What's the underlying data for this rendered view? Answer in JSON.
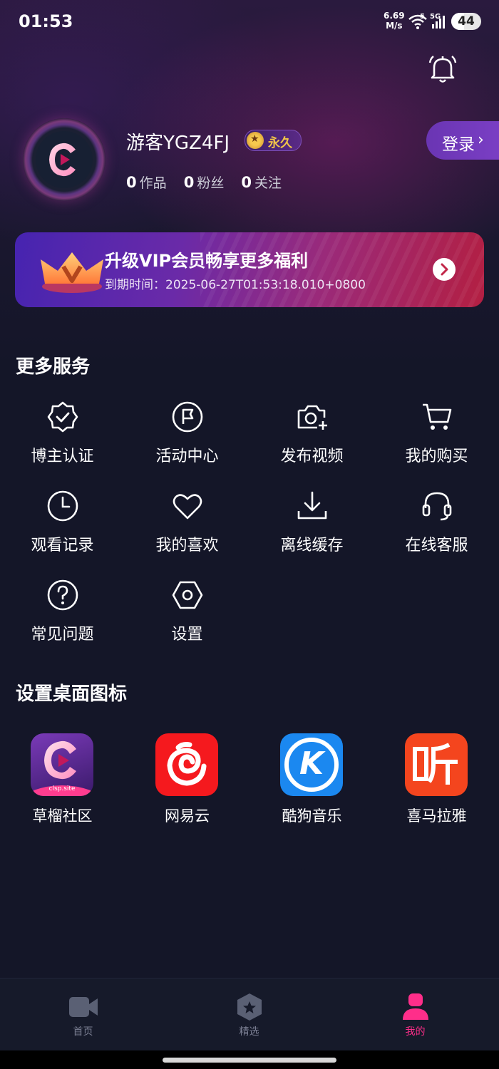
{
  "status_bar": {
    "time": "01:53",
    "net_speed_value": "6.69",
    "net_speed_unit": "M/s",
    "sim1_tag": "5",
    "sim2_tag": "5G",
    "battery": "44",
    "battery_level_percent": 44
  },
  "profile": {
    "username": "游客YGZ4FJ",
    "vip_badge": "永久",
    "works_count": "0",
    "works_label": "作品",
    "fans_count": "0",
    "fans_label": "粉丝",
    "follow_count": "0",
    "follow_label": "关注",
    "login_label": "登录"
  },
  "vip_banner": {
    "title": "升级VIP会员畅享更多福利",
    "expiry": "到期时间：2025-06-27T01:53:18.010+0800"
  },
  "services": {
    "title": "更多服务",
    "items": [
      {
        "label": "博主认证",
        "icon": "verified-badge-icon"
      },
      {
        "label": "活动中心",
        "icon": "flag-icon"
      },
      {
        "label": "发布视频",
        "icon": "camera-plus-icon"
      },
      {
        "label": "我的购买",
        "icon": "cart-icon"
      },
      {
        "label": "观看记录",
        "icon": "clock-icon"
      },
      {
        "label": "我的喜欢",
        "icon": "heart-icon"
      },
      {
        "label": "离线缓存",
        "icon": "download-icon"
      },
      {
        "label": "在线客服",
        "icon": "headset-icon"
      },
      {
        "label": "常见问题",
        "icon": "question-icon"
      },
      {
        "label": "设置",
        "icon": "settings-hex-icon"
      }
    ]
  },
  "desktop_icons": {
    "title": "设置桌面图标",
    "apps": [
      {
        "label": "草榴社区",
        "icon": "caoliu-app-icon",
        "caption": "clsp.site"
      },
      {
        "label": "网易云",
        "icon": "netease-music-icon"
      },
      {
        "label": "酷狗音乐",
        "icon": "kugou-icon",
        "letter": "K"
      },
      {
        "label": "喜马拉雅",
        "icon": "ximalaya-icon"
      }
    ]
  },
  "tabbar": {
    "tabs": [
      {
        "label": "首页",
        "icon": "video-camera-icon"
      },
      {
        "label": "精选",
        "icon": "star-hex-icon"
      },
      {
        "label": "我的",
        "icon": "person-icon"
      }
    ]
  },
  "colors": {
    "background": "#141628",
    "accent_pink": "#ff2e8a",
    "vip_gold": "#f2c648",
    "login_purple": "#7b3fc5"
  }
}
